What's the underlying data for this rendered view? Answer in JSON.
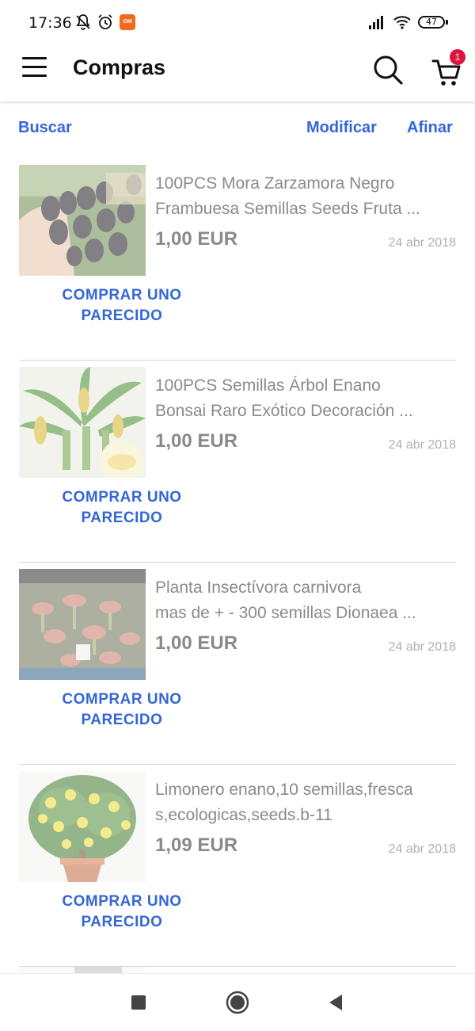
{
  "status_bar": {
    "time": "17:36",
    "battery": "47",
    "icons": [
      "mute-bell-icon",
      "alarm-icon",
      "notification-app-icon",
      "signal-icon",
      "wifi-icon",
      "battery-icon"
    ],
    "notif_app_label": "GM"
  },
  "app_bar": {
    "title": "Compras",
    "menu_icon": "hamburger-menu-icon",
    "search_icon": "search-icon",
    "cart_icon": "cart-icon",
    "cart_count": "1"
  },
  "actions": {
    "search_label": "Buscar",
    "modify_label": "Modificar",
    "refine_label": "Afinar"
  },
  "items": [
    {
      "title_line1": "100PCS Mora Zarzamora Negro",
      "title_line2": "Frambuesa Semillas Seeds Fruta ...",
      "price": "1,00 EUR",
      "date": "24 abr 2018",
      "buy_line1": "COMPRAR UNO",
      "buy_line2": "PARECIDO",
      "image": "blackberries-photo"
    },
    {
      "title_line1": "100PCS Semillas Árbol Enano",
      "title_line2": "Bonsai Raro Exótico Decoración ...",
      "price": "1,00 EUR",
      "date": "24 abr 2018",
      "buy_line1": "COMPRAR UNO",
      "buy_line2": "PARECIDO",
      "image": "dwarf-banana-plant-photo"
    },
    {
      "title_line1": "Planta Insectívora carnivora",
      "title_line2": "mas de + - 300 semillas Dionaea ...",
      "price": "1,00 EUR",
      "date": "24 abr 2018",
      "buy_line1": "COMPRAR UNO",
      "buy_line2": "PARECIDO",
      "image": "venus-flytrap-photo"
    },
    {
      "title_line1": "Limonero enano,10 semillas,fresca",
      "title_line2": "s,ecologicas,seeds.b-11",
      "price": "1,09 EUR",
      "date": "24 abr 2018",
      "buy_line1": "COMPRAR UNO",
      "buy_line2": "PARECIDO",
      "image": "lemon-tree-photo"
    }
  ],
  "nav_bar": {
    "icons": [
      "recents-square-icon",
      "home-circle-icon",
      "back-triangle-icon"
    ]
  },
  "colors": {
    "accent": "#3466d6",
    "badge": "#e0143c",
    "text_muted": "#8a8a8a"
  }
}
